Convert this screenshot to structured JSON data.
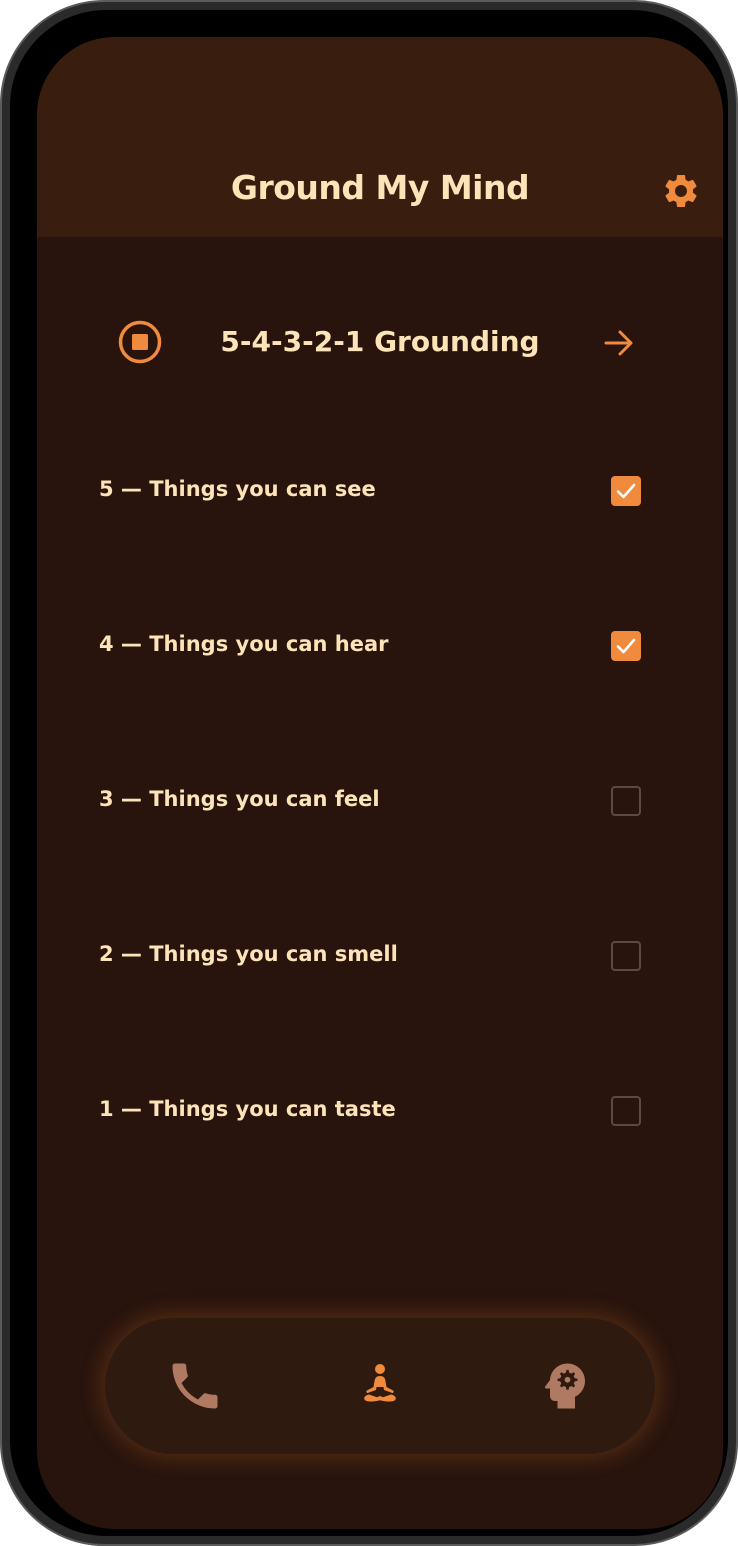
{
  "app": {
    "title": "Ground My Mind"
  },
  "header": {
    "settings_icon": "gear-icon"
  },
  "exercise": {
    "title": "5-4-3-2-1 Grounding",
    "stop_icon": "stop-circle-icon",
    "next_icon": "arrow-right-icon"
  },
  "steps": [
    {
      "label": "5 — Things you can see",
      "checked": true
    },
    {
      "label": "4 — Things you can hear",
      "checked": true
    },
    {
      "label": "3 — Things you can feel",
      "checked": false
    },
    {
      "label": "2 — Things you can smell",
      "checked": false
    },
    {
      "label": "1 — Things you can taste",
      "checked": false
    }
  ],
  "bottom_nav": {
    "items": [
      {
        "icon": "phone-icon",
        "active": false
      },
      {
        "icon": "meditation-icon",
        "active": true
      },
      {
        "icon": "mind-settings-icon",
        "active": false
      }
    ]
  },
  "colors": {
    "background": "#28140d",
    "header_background": "#391e0f",
    "text": "#fde3b8",
    "accent": "#f08a3c",
    "inactive_icon": "#b07a62"
  }
}
